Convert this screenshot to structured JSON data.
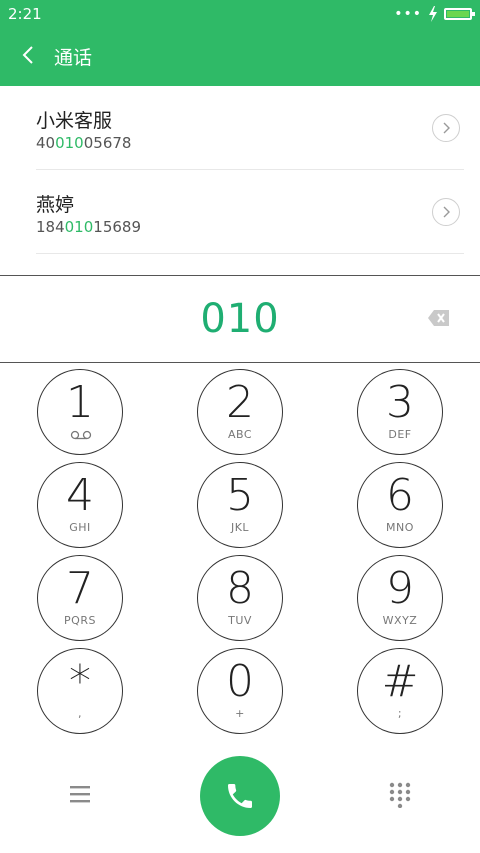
{
  "status_bar": {
    "time": "2:21",
    "dots": "•••"
  },
  "header": {
    "title": "通话"
  },
  "results": [
    {
      "name": "小米客服",
      "number_prefix": "40",
      "number_match": "010",
      "number_suffix": "05678"
    },
    {
      "name": "燕婷",
      "number_prefix": "184",
      "number_match": "010",
      "number_suffix": "15689"
    }
  ],
  "input": {
    "dialed_number": "010"
  },
  "keypad": {
    "keys": [
      {
        "digit": "1",
        "letters": ""
      },
      {
        "digit": "2",
        "letters": "ABC"
      },
      {
        "digit": "3",
        "letters": "DEF"
      },
      {
        "digit": "4",
        "letters": "GHI"
      },
      {
        "digit": "5",
        "letters": "JKL"
      },
      {
        "digit": "6",
        "letters": "MNO"
      },
      {
        "digit": "7",
        "letters": "PQRS"
      },
      {
        "digit": "8",
        "letters": "TUV"
      },
      {
        "digit": "9",
        "letters": "WXYZ"
      },
      {
        "digit": "*",
        "letters": ","
      },
      {
        "digit": "0",
        "letters": "+"
      },
      {
        "digit": "#",
        "letters": ";"
      }
    ]
  },
  "colors": {
    "accent": "#2fba67",
    "match": "#2fba67",
    "dialed": "#1fae72"
  },
  "icons": {
    "back": "back-arrow-icon",
    "detail": "chevron-right-icon",
    "backspace": "backspace-icon",
    "voicemail": "voicemail-icon",
    "menu": "menu-icon",
    "call": "phone-icon",
    "keypad_toggle": "dialpad-icon",
    "charging": "lightning-icon",
    "battery": "battery-icon"
  }
}
